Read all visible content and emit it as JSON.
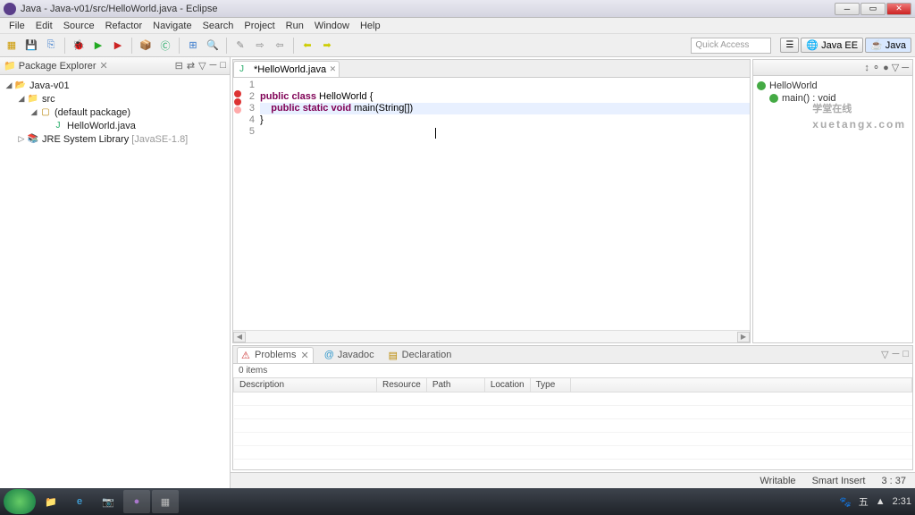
{
  "window": {
    "title": "Java - Java-v01/src/HelloWorld.java - Eclipse"
  },
  "menu": [
    "File",
    "Edit",
    "Source",
    "Refactor",
    "Navigate",
    "Search",
    "Project",
    "Run",
    "Window",
    "Help"
  ],
  "quick_access": "Quick Access",
  "perspectives": [
    "Java EE",
    "Java"
  ],
  "package_explorer": {
    "title": "Package Explorer",
    "project": "Java-v01",
    "src": "src",
    "pkg": "(default package)",
    "file": "HelloWorld.java",
    "jre": "JRE System Library",
    "jre_ver": "[JavaSE-1.8]"
  },
  "editor": {
    "tab": "*HelloWorld.java",
    "lines": [
      "",
      "public class HelloWorld {",
      "    public static void main(String[])",
      "}",
      ""
    ],
    "markers": {
      "2": "err",
      "3": "err",
      "4": "err_light"
    }
  },
  "outline": {
    "class": "HelloWorld",
    "method": "main() : void"
  },
  "problems": {
    "tabs": [
      "Problems",
      "Javadoc",
      "Declaration"
    ],
    "count": "0 items",
    "cols": [
      "Description",
      "Resource",
      "Path",
      "Location",
      "Type"
    ]
  },
  "status": {
    "writable": "Writable",
    "mode": "Smart Insert",
    "pos": "3 : 37"
  },
  "taskbar": {
    "time": "2:31"
  },
  "watermark": {
    "main": "学堂在线",
    "sub": "xuetangx.com"
  }
}
